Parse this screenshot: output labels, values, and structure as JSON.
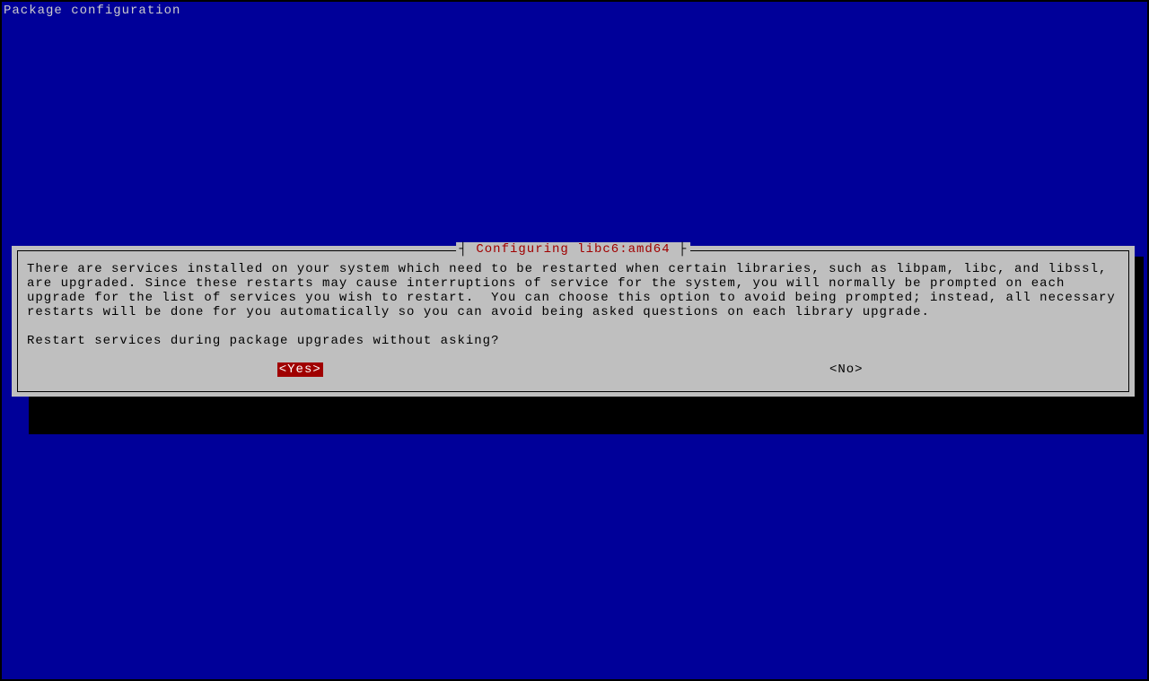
{
  "header": {
    "title": "Package configuration"
  },
  "dialog": {
    "title": "Configuring libc6:amd64",
    "body_text": "There are services installed on your system which need to be restarted when certain libraries, such as libpam, libc, and libssl, are upgraded. Since these restarts may cause interruptions of service for the system, you will normally be prompted on each upgrade for the list of services you wish to restart.  You can choose this option to avoid being prompted; instead, all necessary restarts will be done for you automatically so you can avoid being asked questions on each library upgrade.",
    "question": "Restart services during package upgrades without asking?",
    "buttons": {
      "yes": "<Yes>",
      "no": "<No>"
    }
  }
}
